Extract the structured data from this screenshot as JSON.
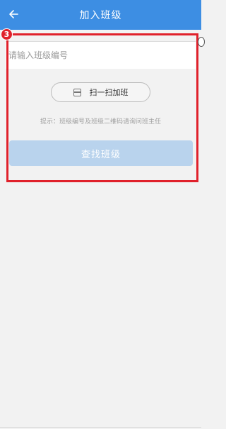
{
  "header": {
    "title": "加入班级",
    "back_icon": "arrow-left-icon"
  },
  "form": {
    "placeholder": "请输入班级编号",
    "value": ""
  },
  "scan": {
    "label": "扫一扫加班",
    "icon": "scan-icon"
  },
  "hint": "提示：班级编号及班级二维码请询问班主任",
  "find_button": {
    "label": "查找班级"
  },
  "annotation": {
    "step_number": "3",
    "color": "#e0212b"
  },
  "colors": {
    "header_bg": "#3d8ee3",
    "find_button_bg": "#b9d3ed",
    "page_bg": "#f2f2f2"
  }
}
